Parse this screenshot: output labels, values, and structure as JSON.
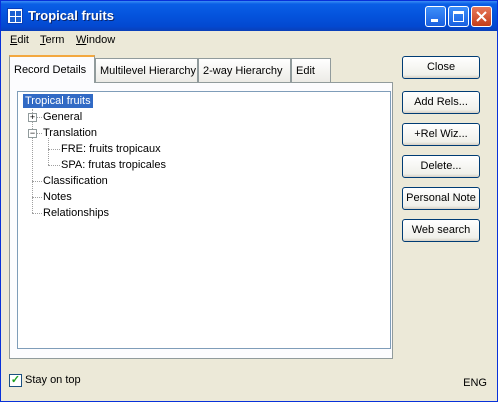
{
  "window": {
    "title": "Tropical fruits"
  },
  "menu": [
    {
      "first": "E",
      "rest": "dit"
    },
    {
      "first": "T",
      "rest": "erm"
    },
    {
      "first": "W",
      "rest": "indow"
    }
  ],
  "tabs": [
    {
      "label": "Record Details",
      "active": true
    },
    {
      "label": "Multilevel Hierarchy",
      "active": false
    },
    {
      "label": "2-way Hierarchy",
      "active": false
    },
    {
      "label": "Edit",
      "active": false
    }
  ],
  "tree": {
    "root": "Tropical fruits",
    "general": "General",
    "translation": "Translation",
    "fre": "FRE: fruits tropicaux",
    "spa": "SPA: frutas tropicales",
    "classification": "Classification",
    "notes": "Notes",
    "relationships": "Relationships"
  },
  "buttons": {
    "close": "Close",
    "add_rels": "Add Rels...",
    "rel_wiz": "+Rel Wiz...",
    "delete": "Delete...",
    "personal_note": "Personal Note",
    "web_search": "Web search"
  },
  "footer": {
    "stay_on_top": "Stay on top",
    "stay_checked": true,
    "language": "ENG"
  }
}
